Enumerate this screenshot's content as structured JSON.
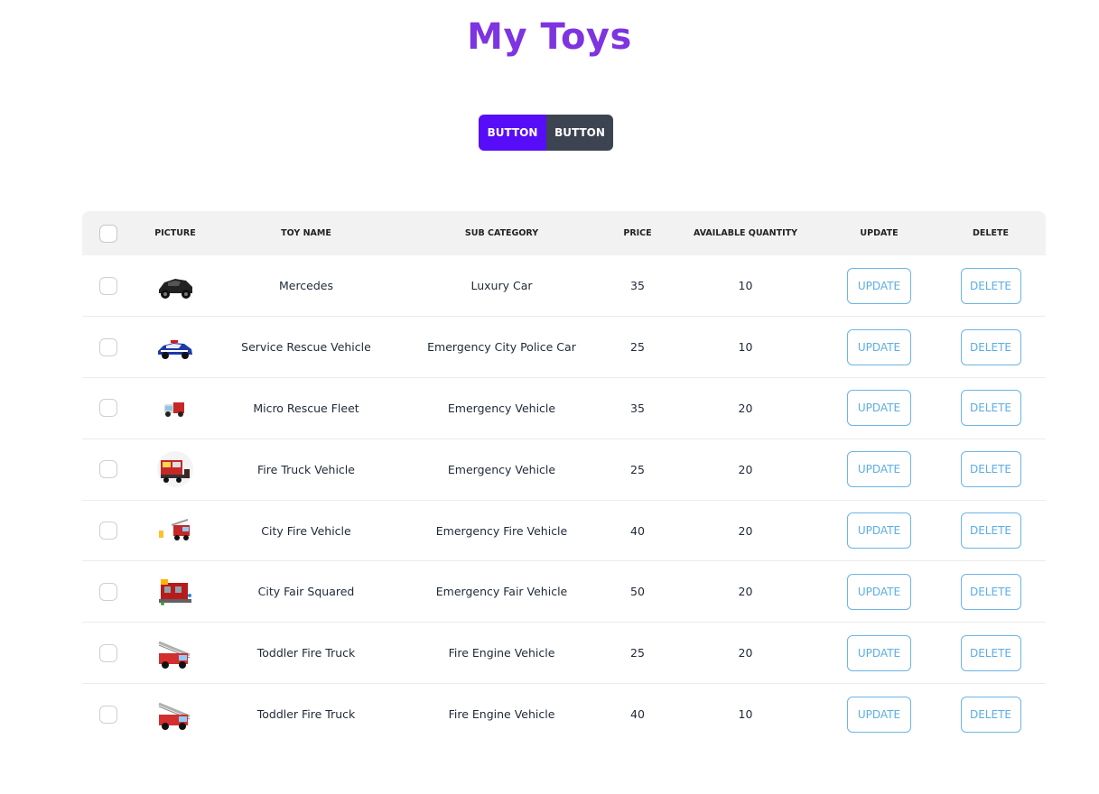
{
  "page": {
    "title": "My Toys"
  },
  "tabs": [
    {
      "label": "BUTTON"
    },
    {
      "label": "BUTTON"
    }
  ],
  "colors": {
    "title": "#7e34e0",
    "primary": "#570df8",
    "neutral": "#3d4451",
    "action_outline": "#6cb5e6"
  },
  "table": {
    "headers": {
      "picture": "PICTURE",
      "toy_name": "TOY NAME",
      "sub_category": "SUB CATEGORY",
      "price": "PRICE",
      "quantity": "AVAILABLE QUANTITY",
      "update": "UPDATE",
      "delete": "DELETE"
    },
    "rows": [
      {
        "name": "Mercedes",
        "sub": "Luxury Car",
        "price": "35",
        "qty": "10",
        "update": "UPDATE",
        "delete": "DELETE",
        "thumb": "black-car"
      },
      {
        "name": "Service Rescue Vehicle",
        "sub": "Emergency City Police Car",
        "price": "25",
        "qty": "10",
        "update": "UPDATE",
        "delete": "DELETE",
        "thumb": "police-car"
      },
      {
        "name": "Micro Rescue Fleet",
        "sub": "Emergency Vehicle",
        "price": "35",
        "qty": "20",
        "update": "UPDATE",
        "delete": "DELETE",
        "thumb": "small-rescue"
      },
      {
        "name": "Fire Truck Vehicle",
        "sub": "Emergency Vehicle",
        "price": "25",
        "qty": "20",
        "update": "UPDATE",
        "delete": "DELETE",
        "thumb": "fire-truck"
      },
      {
        "name": "City Fire Vehicle",
        "sub": "Emergency Fire Vehicle",
        "price": "40",
        "qty": "20",
        "update": "UPDATE",
        "delete": "DELETE",
        "thumb": "fire-vehicle"
      },
      {
        "name": "City Fair Squared",
        "sub": "Emergency Fair Vehicle",
        "price": "50",
        "qty": "20",
        "update": "UPDATE",
        "delete": "DELETE",
        "thumb": "fire-station"
      },
      {
        "name": "Toddler Fire Truck",
        "sub": "Fire Engine Vehicle",
        "price": "25",
        "qty": "20",
        "update": "UPDATE",
        "delete": "DELETE",
        "thumb": "ladder-truck"
      },
      {
        "name": "Toddler Fire Truck",
        "sub": "Fire Engine Vehicle",
        "price": "40",
        "qty": "10",
        "update": "UPDATE",
        "delete": "DELETE",
        "thumb": "ladder-truck"
      }
    ]
  }
}
